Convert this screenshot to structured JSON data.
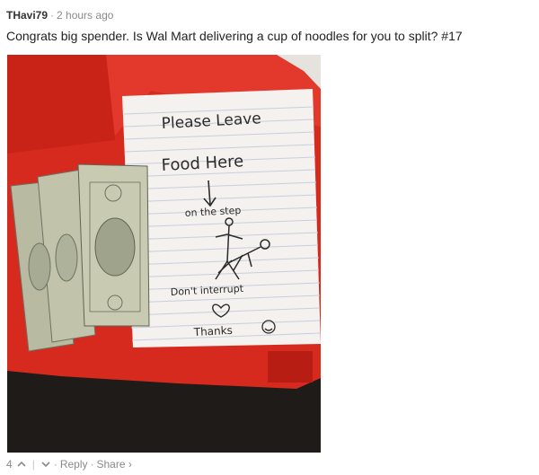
{
  "comment": {
    "username": "THavi79",
    "time_ago": "2 hours ago",
    "text": "Congrats big spender. Is Wal Mart delivering a cup of noodles for you to split? #17"
  },
  "note": {
    "line1": "Please Leave",
    "line2": "Food Here",
    "line3": "on the step",
    "line4": "Don't interrupt",
    "line5": "Thanks"
  },
  "footer": {
    "upvotes": "4",
    "reply_label": "Reply",
    "share_label": "Share ›"
  }
}
